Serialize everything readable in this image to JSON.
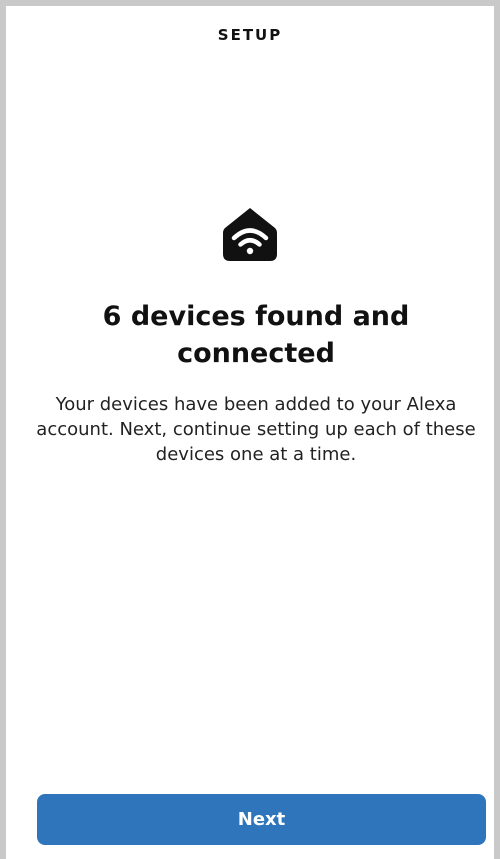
{
  "header": {
    "title": "SETUP"
  },
  "icon": {
    "name": "smart-home-wifi-icon",
    "color": "#111111"
  },
  "main": {
    "headline": "6 devices found and connected",
    "body": "Your devices have been added to your Alexa account. Next, continue setting up each of these devices one at a time."
  },
  "footer": {
    "next_label": "Next"
  },
  "colors": {
    "primary_button": "#2f75bb",
    "frame_border": "#c9c9c9",
    "text": "#111111"
  }
}
